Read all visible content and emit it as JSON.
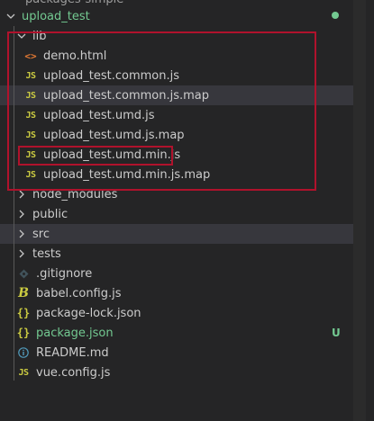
{
  "top_partial": "packages-simple",
  "project": {
    "name": "upload_test"
  },
  "tree": {
    "lib": {
      "label": "lib",
      "children": [
        {
          "label": "demo.html",
          "icon": "html-icon"
        },
        {
          "label": "upload_test.common.js",
          "icon": "js-icon"
        },
        {
          "label": "upload_test.common.js.map",
          "icon": "js-icon"
        },
        {
          "label": "upload_test.umd.js",
          "icon": "js-icon"
        },
        {
          "label": "upload_test.umd.js.map",
          "icon": "js-icon"
        },
        {
          "label": "upload_test.umd.min.js",
          "icon": "js-icon"
        },
        {
          "label": "upload_test.umd.min.js.map",
          "icon": "js-icon"
        }
      ]
    },
    "folders": [
      "node_modules",
      "public",
      "src",
      "tests"
    ],
    "files": [
      {
        "label": ".gitignore"
      },
      {
        "label": "babel.config.js"
      },
      {
        "label": "package-lock.json"
      },
      {
        "label": "package.json",
        "badge": "U"
      },
      {
        "label": "README.md"
      },
      {
        "label": "vue.config.js"
      }
    ]
  },
  "icons": {
    "js": "JS",
    "html": "<>",
    "braces": "{}",
    "babel": "B"
  },
  "colors": {
    "background": "#252526",
    "text": "#cccccc",
    "git_untracked": "#73c991",
    "js_icon": "#cbcb41",
    "html_icon": "#e37933",
    "highlight_box": "#b0122c"
  }
}
